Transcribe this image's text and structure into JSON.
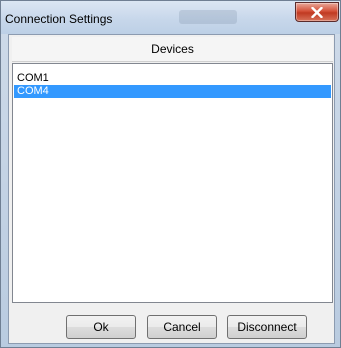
{
  "window": {
    "title": "Connection Settings"
  },
  "devices": {
    "header": "Devices",
    "items": [
      {
        "label": "COM1",
        "selected": false
      },
      {
        "label": "COM4",
        "selected": true
      }
    ]
  },
  "buttons": {
    "ok": "Ok",
    "cancel": "Cancel",
    "disconnect": "Disconnect"
  },
  "colors": {
    "selection": "#3399ff",
    "close_button": "#c8432b"
  }
}
